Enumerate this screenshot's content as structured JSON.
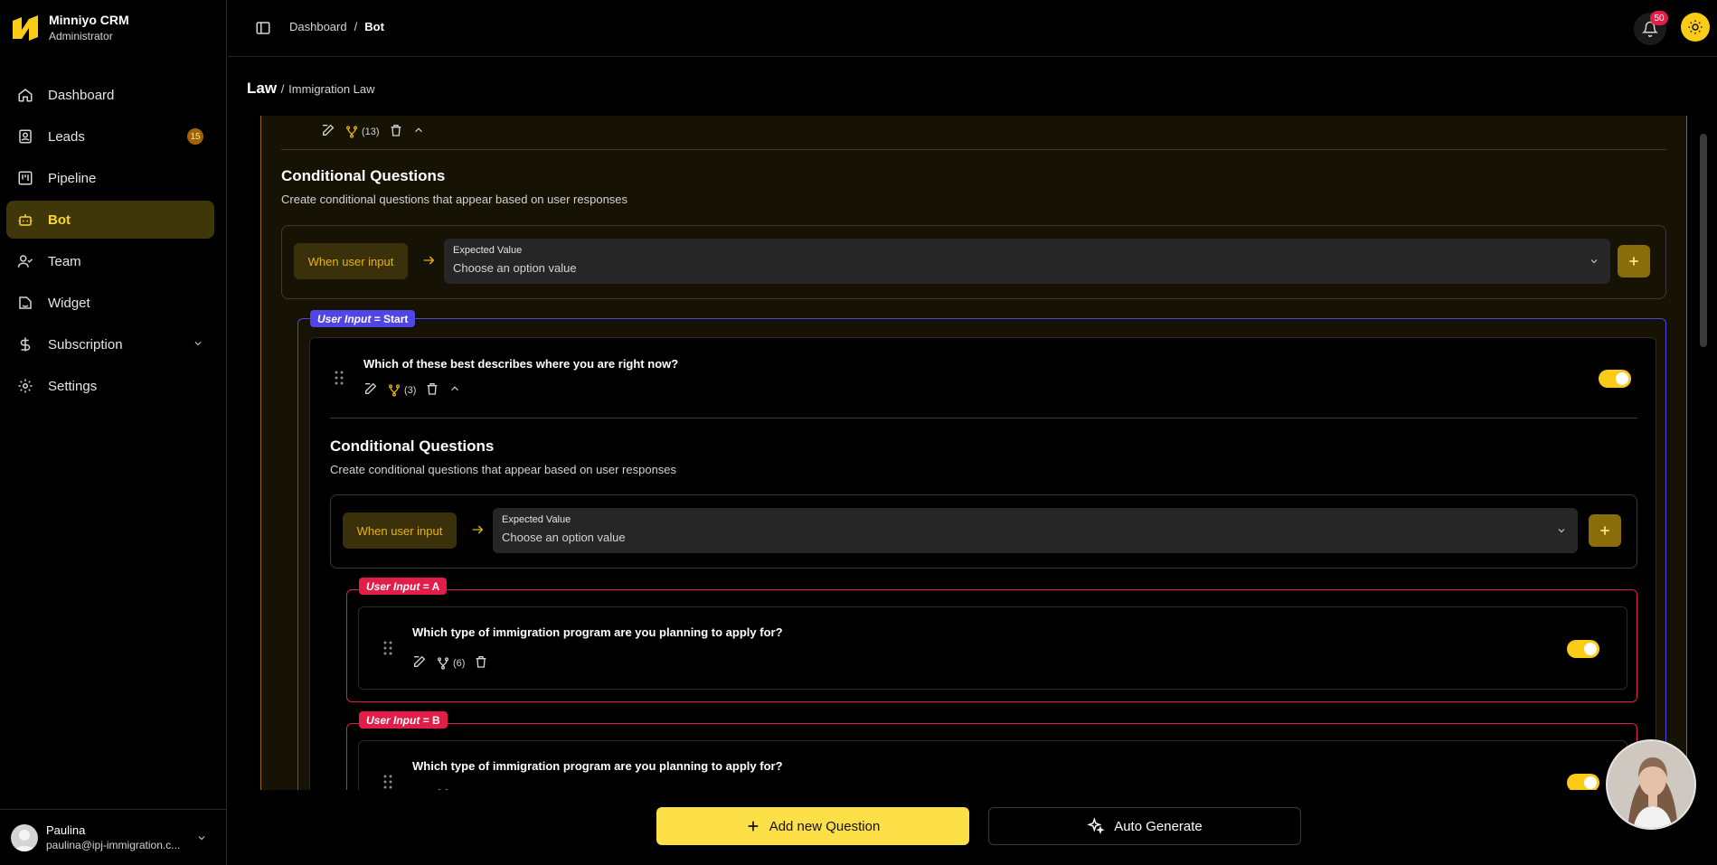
{
  "app": {
    "name": "Minniyo CRM",
    "role": "Administrator"
  },
  "sidebar": {
    "items": [
      {
        "label": "Dashboard",
        "icon": "home-icon"
      },
      {
        "label": "Leads",
        "icon": "contact-icon",
        "badge": "15"
      },
      {
        "label": "Pipeline",
        "icon": "kanban-icon"
      },
      {
        "label": "Bot",
        "icon": "bot-icon",
        "active": true
      },
      {
        "label": "Team",
        "icon": "users-icon"
      },
      {
        "label": "Widget",
        "icon": "widget-icon"
      },
      {
        "label": "Subscription",
        "icon": "dollar-icon"
      },
      {
        "label": "Settings",
        "icon": "gear-icon"
      }
    ]
  },
  "user": {
    "name": "Paulina",
    "email": "paulina@ipj-immigration.c..."
  },
  "topbar": {
    "breadcrumb": [
      "Dashboard",
      "Bot"
    ],
    "separator": "/",
    "notifications": "50"
  },
  "page": {
    "title": "Law",
    "separator": "/",
    "subtitle": "Immigration Law"
  },
  "outer": {
    "branch_count": "(13)",
    "conditional": {
      "title": "Conditional Questions",
      "description": "Create conditional questions that appear based on user responses",
      "when_label": "When user input",
      "select_label": "Expected Value",
      "select_placeholder": "Choose an option value"
    }
  },
  "branch_start": {
    "tag_prefix": "User Input",
    "tag_value": "= Start",
    "question": "Which of these best describes where you are right now?",
    "branch_count": "(3)",
    "conditional": {
      "title": "Conditional Questions",
      "description": "Create conditional questions that appear based on user responses",
      "when_label": "When user input",
      "select_label": "Expected Value",
      "select_placeholder": "Choose an option value"
    }
  },
  "branch_a": {
    "tag_prefix": "User Input",
    "tag_value": "= A",
    "question": "Which type of immigration program are you planning to apply for?",
    "branch_count": "(6)"
  },
  "branch_b": {
    "tag_prefix": "User Input",
    "tag_value": "= B",
    "question": "Which type of immigration program are you planning to apply for?"
  },
  "actions": {
    "add": "Add new Question",
    "auto": "Auto Generate"
  },
  "colors": {
    "accent": "#facc15",
    "active_bg": "#3f370a",
    "tag_blue": "#4f46e5",
    "tag_red": "#e11d48"
  }
}
